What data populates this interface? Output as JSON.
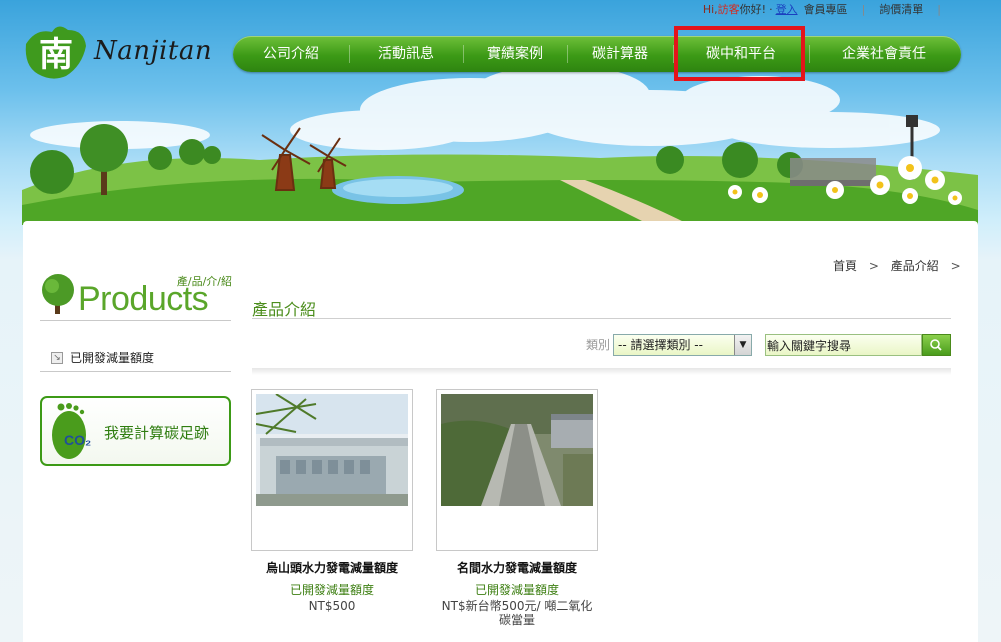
{
  "topbar": {
    "greeting_hi": "Hi,",
    "guest": "訪客",
    "greeting_tail": "你好!",
    "dot": "·",
    "login_link": "登入",
    "member_area": "會員專區",
    "separator": "|",
    "inquiry_list": "詢價清單"
  },
  "logo": {
    "wordmark": "Nanjitan"
  },
  "nav": {
    "items": [
      {
        "label": "公司介紹"
      },
      {
        "label": "活動訊息"
      },
      {
        "label": "實績案例"
      },
      {
        "label": "碳計算器"
      },
      {
        "label": "碳中和平台",
        "highlighted": true
      },
      {
        "label": "企業社會責任"
      }
    ],
    "highlight_color": "#e4141b"
  },
  "breadcrumb": {
    "home": "首頁",
    "arrow": ">",
    "current": "產品介紹",
    "trailing_arrow": ">"
  },
  "sidebar": {
    "title_small": "產/品/介/紹",
    "title_big": "Products",
    "category_item": "已開發減量額度",
    "footprint_button": "我要計算碳足跡"
  },
  "main": {
    "title": "產品介紹",
    "filter_label": "類別",
    "category_select": "-- 請選擇類別 --",
    "search_value": "輸入關鍵字搜尋"
  },
  "products": [
    {
      "name": "烏山頭水力發電減量額度",
      "category": "已開發減量額度",
      "price": "NT$500"
    },
    {
      "name": "名間水力發電減量額度",
      "category": "已開發減量額度",
      "price_line1": "NT$新台幣500元/ 噸二氧化",
      "price_line2": "碳當量"
    }
  ],
  "colors": {
    "nav_green": "#3c9a16",
    "accent_green": "#4b8d1c",
    "guest_red": "#d42a1e",
    "link_blue": "#1a3fbf"
  }
}
